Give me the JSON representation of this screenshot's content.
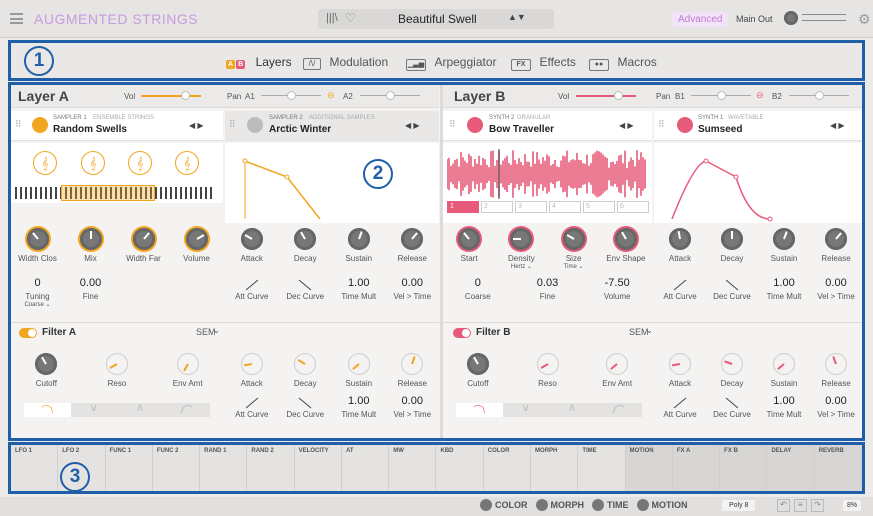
{
  "topbar": {
    "app_title": "AUGMENTED STRINGS",
    "preset_name": "Beautiful Swell",
    "advanced_label": "Advanced",
    "main_out_label": "Main Out"
  },
  "nav": {
    "tabs": [
      {
        "label": "Layers",
        "icon": "layers-icon"
      },
      {
        "label": "Modulation",
        "icon": "modulation-icon"
      },
      {
        "label": "Arpeggiator",
        "icon": "arpeggiator-icon"
      },
      {
        "label": "Effects",
        "icon": "effects-icon"
      },
      {
        "label": "Macros",
        "icon": "macros-icon"
      }
    ],
    "ab_badge_a": "A",
    "ab_badge_b": "B",
    "fx_badge": "FX"
  },
  "badges": {
    "one": "1",
    "two": "2",
    "three": "3"
  },
  "layerA": {
    "title": "Layer A",
    "vol_label": "Vol",
    "pan_label": "Pan",
    "a1": "A1",
    "a2": "A2",
    "slot1": {
      "type": "SAMPLER 1",
      "category": "ENSEMBLE STRINGS",
      "name": "Random Swells"
    },
    "slot2": {
      "type": "SAMPLER 2",
      "category": "ADDITIONAL SAMPLES",
      "name": "Arctic Winter"
    },
    "knobs1": [
      "Width Clos",
      "Mix",
      "Width Far",
      "Volume"
    ],
    "values1": [
      {
        "value": "0",
        "label": "Tuning",
        "sub": "Coarse"
      },
      {
        "value": "0.00",
        "label": "Fine"
      }
    ],
    "knobs2": [
      "Attack",
      "Decay",
      "Sustain",
      "Release"
    ],
    "values2": [
      {
        "value": "",
        "label": "Att Curve"
      },
      {
        "value": "",
        "label": "Dec Curve"
      },
      {
        "value": "1.00",
        "label": "Time Mult"
      },
      {
        "value": "0.00",
        "label": "Vel > Time"
      }
    ],
    "filter": {
      "title": "Filter A",
      "type": "SEM",
      "knobs": [
        "Cutoff",
        "Reso",
        "Env Amt"
      ]
    },
    "fenv": {
      "knobs": [
        "Attack",
        "Decay",
        "Sustain",
        "Release"
      ],
      "values": [
        {
          "value": "",
          "label": "Att Curve"
        },
        {
          "value": "",
          "label": "Dec Curve"
        },
        {
          "value": "1.00",
          "label": "Time Mult"
        },
        {
          "value": "0.00",
          "label": "Vel > Time"
        }
      ]
    }
  },
  "layerB": {
    "title": "Layer B",
    "vol_label": "Vol",
    "pan_label": "Pan",
    "b1": "B1",
    "b2": "B2",
    "slot1": {
      "type": "SYNTH 2",
      "category": "GRANULAR",
      "name": "Bow Traveller"
    },
    "slot2": {
      "type": "SYNTH 1",
      "category": "WAVETABLE",
      "name": "Sumseed"
    },
    "grain_slots": [
      "1",
      "2",
      "3",
      "4",
      "5",
      "6"
    ],
    "knobs1": [
      {
        "label": "Start",
        "sub": ""
      },
      {
        "label": "Density",
        "sub": "Hertz"
      },
      {
        "label": "Size",
        "sub": "Time"
      },
      {
        "label": "Env Shape",
        "sub": ""
      }
    ],
    "values1": [
      {
        "value": "0",
        "label": "Coarse"
      },
      {
        "value": "0.03",
        "label": "Fine"
      },
      {
        "value": "-7.50",
        "label": "Volume"
      }
    ],
    "knobs2": [
      "Attack",
      "Decay",
      "Sustain",
      "Release"
    ],
    "values2": [
      {
        "value": "",
        "label": "Att Curve"
      },
      {
        "value": "",
        "label": "Dec Curve"
      },
      {
        "value": "1.00",
        "label": "Time Mult"
      },
      {
        "value": "0.00",
        "label": "Vel > Time"
      }
    ],
    "filter": {
      "title": "Filter B",
      "type": "SEM",
      "knobs": [
        "Cutoff",
        "Reso",
        "Env Amt"
      ]
    },
    "fenv": {
      "knobs": [
        "Attack",
        "Decay",
        "Sustain",
        "Release"
      ],
      "values": [
        {
          "value": "",
          "label": "Att Curve"
        },
        {
          "value": "",
          "label": "Dec Curve"
        },
        {
          "value": "1.00",
          "label": "Time Mult"
        },
        {
          "value": "0.00",
          "label": "Vel > Time"
        }
      ]
    }
  },
  "mod_sources": [
    "LFO 1",
    "LFO 2",
    "FUNC 1",
    "FUNC 2",
    "RAND 1",
    "RAND 2",
    "VELOCITY",
    "AT",
    "MW",
    "KBD",
    "COLOR",
    "MORPH",
    "TIME",
    "MOTION",
    "FX A",
    "FX B",
    "DELAY",
    "REVERB"
  ],
  "bottom": {
    "macros": [
      "COLOR",
      "MORPH",
      "TIME",
      "MOTION"
    ],
    "poly": "Poly 8",
    "zoom": "8%"
  },
  "colors": {
    "accent_a": "#f2a51f",
    "accent_b": "#e85a7a",
    "annotation": "#1f5fa8"
  }
}
